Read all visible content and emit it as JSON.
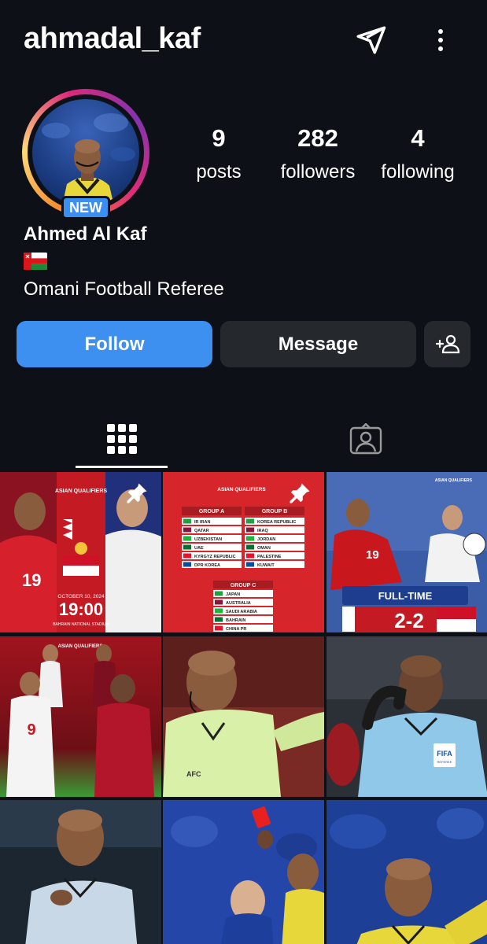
{
  "header": {
    "username": "ahmadal_kaf",
    "icons": [
      "send-icon",
      "more-vertical-icon"
    ]
  },
  "profile": {
    "new_badge": "NEW",
    "full_name": "Ahmed Al Kaf",
    "flag": "oman-flag",
    "bio": "Omani Football Referee",
    "stats": [
      {
        "value": "9",
        "label": "posts"
      },
      {
        "value": "282",
        "label": "followers"
      },
      {
        "value": "4",
        "label": "following"
      }
    ]
  },
  "actions": {
    "follow": "Follow",
    "message": "Message",
    "add_user_icon": "add-person-icon"
  },
  "tabs": [
    {
      "name": "posts-grid",
      "icon": "grid-icon",
      "active": true
    },
    {
      "name": "tagged",
      "icon": "tagged-person-icon",
      "active": false
    }
  ],
  "posts": [
    {
      "pinned": true,
      "texts": {
        "date": "OCTOBER 10, 2024",
        "time": "19:00",
        "venue": "BAHRAIN NATIONAL STADIUM",
        "brand": "ASIAN QUALIFIERS",
        "number": "19"
      }
    },
    {
      "pinned": true,
      "texts": {
        "brand": "ASIAN QUALIFIERS",
        "group_a_title": "GROUP A",
        "group_b_title": "GROUP B",
        "group_c_title": "GROUP C",
        "group_a": [
          "IR IRAN",
          "QATAR",
          "UZBEKISTAN",
          "UAE",
          "KYRGYZ REPUBLIC",
          "DPR KOREA"
        ],
        "group_b": [
          "KOREA REPUBLIC",
          "IRAQ",
          "JORDAN",
          "OMAN",
          "PALESTINE",
          "KUWAIT"
        ],
        "group_c": [
          "JAPAN",
          "AUSTRALIA",
          "SAUDI ARABIA",
          "BAHRAIN",
          "CHINA PR"
        ]
      }
    },
    {
      "pinned": false,
      "texts": {
        "label": "FULL-TIME",
        "score": "2-2",
        "brand": "ASIAN QUALIFIERS",
        "number": "19"
      }
    },
    {
      "pinned": false,
      "texts": {
        "brand": "ASIAN QUALIFIERS",
        "number": "9"
      }
    },
    {
      "pinned": false,
      "texts": {
        "brand": "AFC"
      }
    },
    {
      "pinned": false,
      "texts": {
        "brand": "FIFA",
        "sub": "REFEREE"
      }
    },
    {
      "pinned": false,
      "texts": {}
    },
    {
      "pinned": false,
      "texts": {}
    },
    {
      "pinned": false,
      "texts": {}
    }
  ],
  "colors": {
    "background": "#0d1117",
    "follow_button": "#3d8ff0",
    "secondary_button": "#25282d",
    "new_badge": "#3b8ef2"
  }
}
